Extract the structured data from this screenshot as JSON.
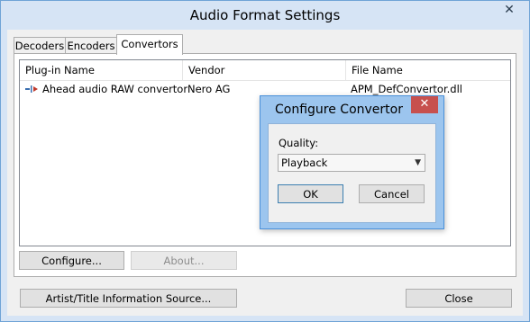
{
  "window": {
    "title": "Audio Format Settings"
  },
  "tabs": [
    {
      "label": "Decoders"
    },
    {
      "label": "Encoders"
    },
    {
      "label": "Convertors"
    }
  ],
  "list": {
    "columns": [
      "Plug-in Name",
      "Vendor",
      "File Name"
    ],
    "rows": [
      {
        "name": "Ahead audio RAW convertor",
        "vendor": "Nero AG",
        "file": "APM_DefConvertor.dll"
      }
    ]
  },
  "panel_buttons": {
    "configure": "Configure...",
    "about": "About..."
  },
  "footer_buttons": {
    "artist": "Artist/Title Information Source...",
    "close": "Close"
  },
  "dialog": {
    "title": "Configure Convertor",
    "quality_label": "Quality:",
    "quality_value": "Playback",
    "ok": "OK",
    "cancel": "Cancel"
  },
  "icons": {
    "window_close": "close-icon",
    "dialog_close": "close-icon",
    "plugin": "plugin-icon",
    "dropdown": "chevron-down-icon"
  },
  "colors": {
    "dialog_close_bg": "#c7504e",
    "dialog_frame": "#9cc5ee",
    "window_frame": "#d6e4f5"
  }
}
